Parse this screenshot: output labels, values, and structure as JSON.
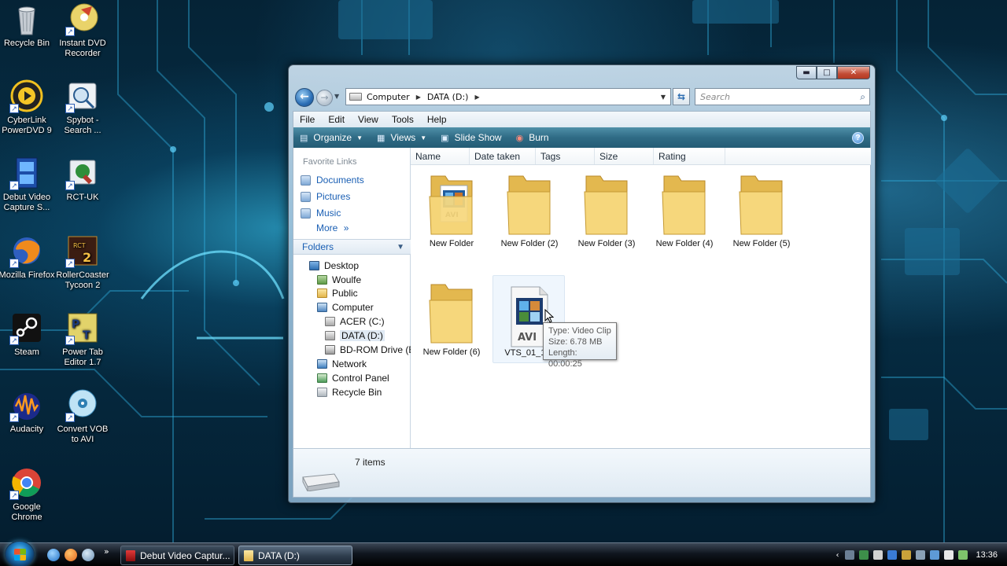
{
  "desktop": {
    "icons": [
      {
        "label": "Recycle Bin"
      },
      {
        "label": "Instant DVD Recorder"
      },
      {
        "label": "CyberLink PowerDVD 9"
      },
      {
        "label": "Spybot - Search ..."
      },
      {
        "label": "Debut Video Capture S..."
      },
      {
        "label": "RCT-UK"
      },
      {
        "label": "Mozilla Firefox"
      },
      {
        "label": "RollerCoaster Tycoon 2"
      },
      {
        "label": "Steam"
      },
      {
        "label": "Power Tab Editor 1.7"
      },
      {
        "label": "Audacity"
      },
      {
        "label": "Convert VOB to AVI"
      },
      {
        "label": "Google Chrome"
      }
    ]
  },
  "window": {
    "controls": {
      "minimize": "▬",
      "maximize": "□",
      "close": "✕"
    },
    "address": {
      "segments": [
        "Computer",
        "DATA (D:)"
      ]
    },
    "search": {
      "placeholder": "Search"
    },
    "menu": [
      "File",
      "Edit",
      "View",
      "Tools",
      "Help"
    ],
    "commands": [
      {
        "label": "Organize",
        "has_dropdown": true
      },
      {
        "label": "Views",
        "has_dropdown": true
      },
      {
        "label": "Slide Show",
        "has_dropdown": false
      },
      {
        "label": "Burn",
        "has_dropdown": false
      }
    ],
    "favorite_links": {
      "title": "Favorite Links",
      "items": [
        "Documents",
        "Pictures",
        "Music"
      ],
      "more": "More"
    },
    "folders": {
      "title": "Folders",
      "tree": [
        {
          "label": "Desktop",
          "level": 0,
          "icon": "desktop-icon"
        },
        {
          "label": "Woulfe",
          "level": 1,
          "icon": "user-folder-icon"
        },
        {
          "label": "Public",
          "level": 1,
          "icon": "folder-icon"
        },
        {
          "label": "Computer",
          "level": 1,
          "icon": "computer-icon"
        },
        {
          "label": "ACER (C:)",
          "level": 2,
          "icon": "hard-drive-icon"
        },
        {
          "label": "DATA (D:)",
          "level": 2,
          "icon": "hard-drive-icon",
          "selected": true
        },
        {
          "label": "BD-ROM Drive (E:",
          "level": 2,
          "icon": "optical-drive-icon"
        },
        {
          "label": "Network",
          "level": 1,
          "icon": "network-icon"
        },
        {
          "label": "Control Panel",
          "level": 1,
          "icon": "control-panel-icon"
        },
        {
          "label": "Recycle Bin",
          "level": 1,
          "icon": "recycle-bin-icon"
        }
      ]
    },
    "columns": [
      "Name",
      "Date taken",
      "Tags",
      "Size",
      "Rating"
    ],
    "items": [
      {
        "label": "New Folder",
        "type": "folder-with-video"
      },
      {
        "label": "New Folder (2)",
        "type": "folder"
      },
      {
        "label": "New Folder (3)",
        "type": "folder"
      },
      {
        "label": "New Folder (4)",
        "type": "folder"
      },
      {
        "label": "New Folder (5)",
        "type": "folder"
      },
      {
        "label": "New Folder (6)",
        "type": "folder"
      },
      {
        "label": "VTS_01_1(x",
        "type": "avi-file"
      }
    ],
    "tooltip": {
      "type": "Type: Video Clip",
      "size": "Size: 6.78 MB",
      "length": "Length: 00:00:25"
    },
    "details": {
      "count": "7 items"
    },
    "avi_badge": "AVI"
  },
  "taskbar": {
    "buttons": [
      {
        "label": "Debut Video Captur...",
        "active": false
      },
      {
        "label": "DATA (D:)",
        "active": true
      }
    ],
    "clock": "13:36",
    "overflow": "»"
  },
  "colors": {
    "command_bar": "#2f6b85",
    "link_blue": "#1a5fb4",
    "folder_yellow": "#f4d27a"
  }
}
